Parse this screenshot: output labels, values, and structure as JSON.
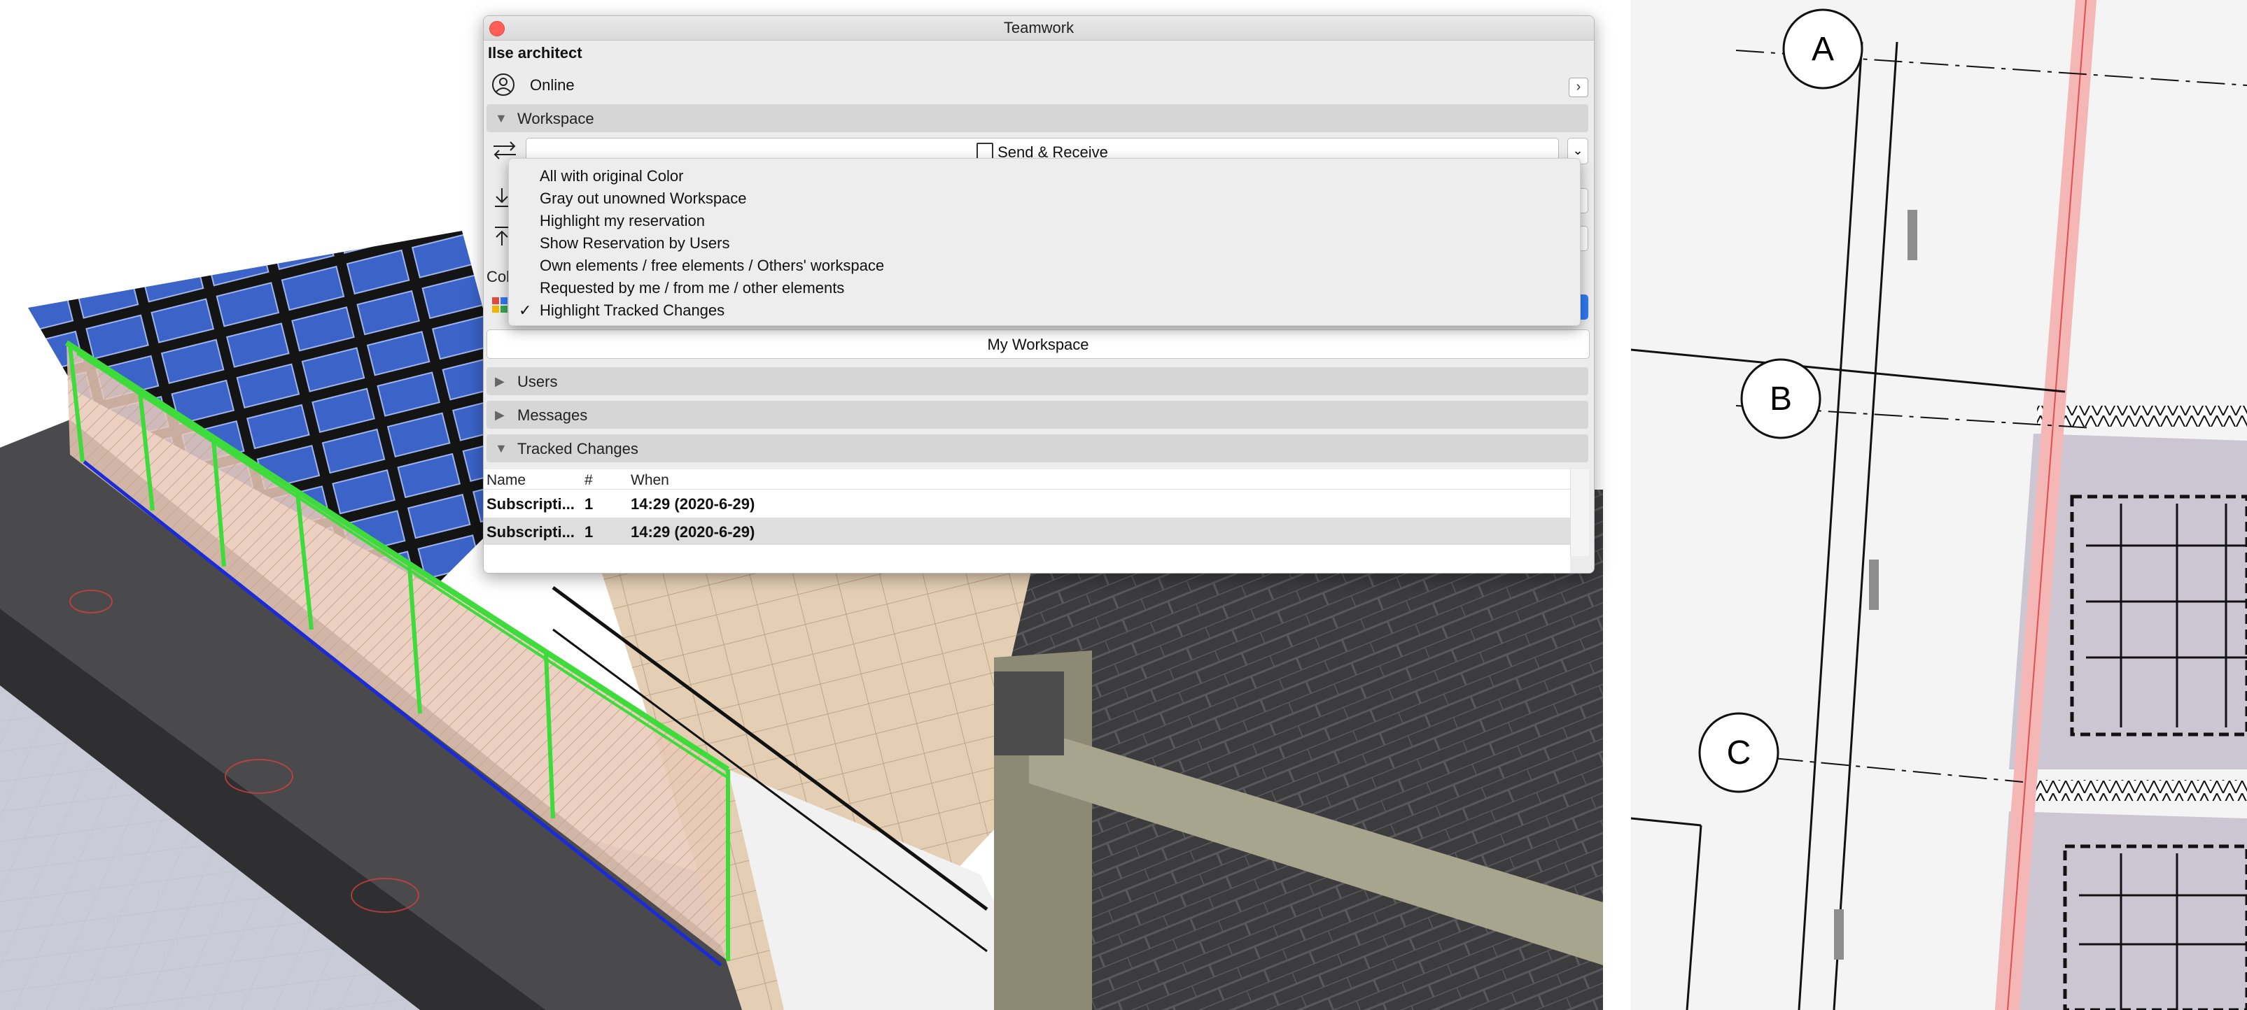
{
  "window": {
    "title": "Teamwork"
  },
  "user": {
    "name": "Ilse architect",
    "status": "Online"
  },
  "workspace": {
    "header": "Workspace",
    "send_receive_label": "Send & Receive",
    "color_label": "Col",
    "my_workspace_button": "My Workspace"
  },
  "display_menu": {
    "items": [
      {
        "label": "All with original Color",
        "checked": false
      },
      {
        "label": "Gray out unowned Workspace",
        "checked": false
      },
      {
        "label": "Highlight my reservation",
        "checked": false
      },
      {
        "label": "Show Reservation by Users",
        "checked": false
      },
      {
        "label": "Own elements / free elements / Others' workspace",
        "checked": false
      },
      {
        "label": "Requested by me / from me / other elements",
        "checked": false
      },
      {
        "label": "Highlight Tracked Changes",
        "checked": true
      }
    ],
    "check_glyph": "✓"
  },
  "sections": {
    "users": "Users",
    "messages": "Messages",
    "tracked_changes": "Tracked Changes"
  },
  "tracked_changes": {
    "columns": [
      "Name",
      "#",
      "When"
    ],
    "rows": [
      {
        "name": "Subscripti...",
        "count": "1",
        "when": "14:29 (2020-6-29)"
      },
      {
        "name": "Subscripti...",
        "count": "1",
        "when": "14:29 (2020-6-29)"
      }
    ]
  },
  "plan": {
    "grid_labels": [
      "A",
      "B",
      "C"
    ]
  },
  "colors": {
    "accent_blue": "#2f7bf6",
    "highlight_green": "#3ddc3a",
    "close_red": "#ff5f57",
    "solar_blue": "#3b63c8",
    "wall_pink": "#f5b6b6"
  },
  "icons": {
    "status": "user-online-icon",
    "send_receive": "send-receive-icon",
    "color_mode": "color-mode-icon"
  }
}
